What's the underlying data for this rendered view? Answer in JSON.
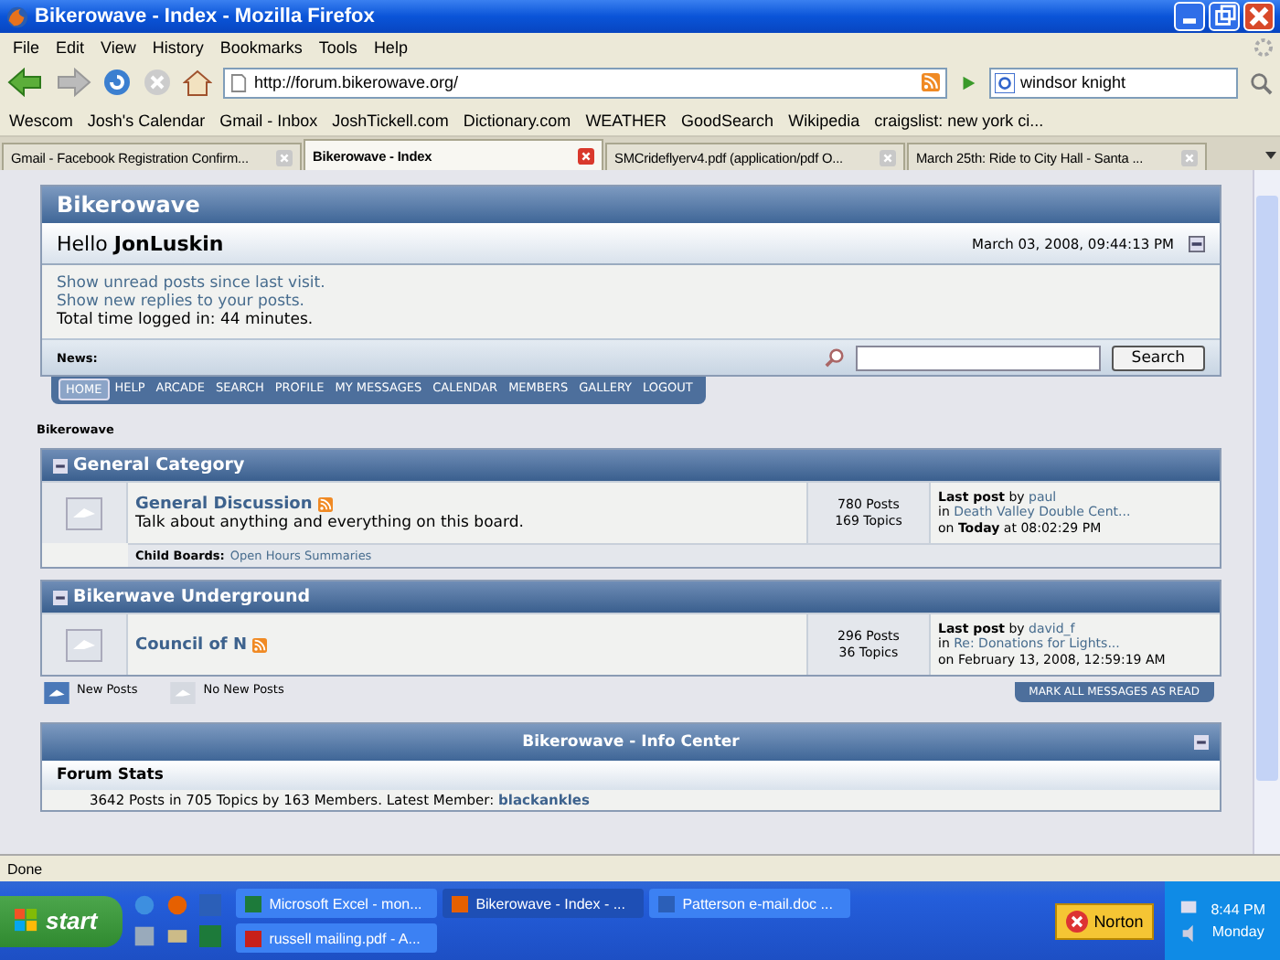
{
  "window": {
    "title": "Bikerowave - Index - Mozilla Firefox"
  },
  "menu": [
    "File",
    "Edit",
    "View",
    "History",
    "Bookmarks",
    "Tools",
    "Help"
  ],
  "toolbar": {
    "url": "http://forum.bikerowave.org/",
    "search_value": "windsor knight"
  },
  "bookmarks": [
    "Wescom",
    "Josh's Calendar",
    "Gmail - Inbox",
    "JoshTickell.com",
    "Dictionary.com",
    "WEATHER",
    "GoodSearch",
    "Wikipedia",
    "craigslist: new york ci..."
  ],
  "tabs": [
    {
      "label": "Gmail - Facebook Registration Confirm...",
      "selected": false
    },
    {
      "label": "Bikerowave - Index",
      "selected": true
    },
    {
      "label": "SMCrideflyerv4.pdf (application/pdf O...",
      "selected": false
    },
    {
      "label": "March 25th: Ride to City Hall - Santa ...",
      "selected": false
    }
  ],
  "forum": {
    "title": "Bikerowave",
    "greeting": "Hello **JonLuskin**",
    "date": "March 03, 2008, 09:44:13 PM",
    "links": [
      "Show unread posts since last visit.",
      "Show new replies to your posts."
    ],
    "total_time": "Total time logged in: 44 minutes.",
    "news_label": "News:",
    "search_button": "Search",
    "nav": [
      {
        "label": "HOME",
        "selected": true
      },
      {
        "label": "HELP",
        "selected": false
      },
      {
        "label": "ARCADE",
        "selected": false
      },
      {
        "label": "SEARCH",
        "selected": false
      },
      {
        "label": "PROFILE",
        "selected": false
      },
      {
        "label": "MY MESSAGES",
        "selected": false
      },
      {
        "label": "CALENDAR",
        "selected": false
      },
      {
        "label": "MEMBERS",
        "selected": false
      },
      {
        "label": "GALLERY",
        "selected": false
      },
      {
        "label": "LOGOUT",
        "selected": false
      }
    ],
    "breadcrumb": "Bikerowave",
    "categories": [
      {
        "title": "General Category",
        "boards": [
          {
            "name": "General Discussion",
            "description": "Talk about anything and everything on this board.",
            "posts": "780 Posts",
            "topics": "169 Topics",
            "last_by": "**Last post** by",
            "last_user": "paul",
            "in_word": "in",
            "last_topic": "Death Valley Double Cent...",
            "last_on": "on **Today** at 08:02:29 PM",
            "child_label": "Child Boards:",
            "child_link": "Open Hours Summaries"
          }
        ]
      },
      {
        "title": "Bikerwave Underground",
        "boards": [
          {
            "name": "Council of N",
            "posts": "296 Posts",
            "topics": "36 Topics",
            "last_by": "**Last post** by",
            "last_user": "david_f",
            "in_word": "in",
            "last_topic": "Re: Donations for Lights...",
            "last_on": "on February 13, 2008, 12:59:19 AM"
          }
        ]
      }
    ],
    "legend": [
      {
        "label": "New Posts",
        "kind": "new"
      },
      {
        "label": "No New Posts",
        "kind": "none"
      }
    ],
    "mark_all": "MARK ALL MESSAGES AS READ",
    "info_title": "Bikerowave - Info Center",
    "stats_title": "Forum Stats",
    "stats_text": "3642 Posts in 705 Topics by 163 Members. Latest Member:",
    "latest_member": "blackankles"
  },
  "status_bar": "Done",
  "taskbar": {
    "start": "start",
    "tasks": [
      {
        "label": "Microsoft Excel - mon...",
        "selected": false,
        "kind": "excel"
      },
      {
        "label": "Bikerowave - Index - ...",
        "selected": true,
        "kind": "firefox"
      },
      {
        "label": "Patterson e-mail.doc ...",
        "selected": false,
        "kind": "doc"
      },
      {
        "label": "russell mailing.pdf - A...",
        "selected": false,
        "kind": "pdf"
      }
    ],
    "norton": "Norton",
    "time": "8:44 PM",
    "day": "Monday"
  }
}
